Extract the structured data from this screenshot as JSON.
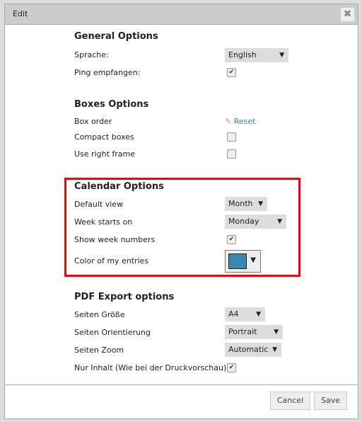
{
  "dialog": {
    "title": "Edit",
    "close_icon": "close-icon"
  },
  "general": {
    "heading": "General Options",
    "language_label": "Sprache:",
    "language_value": "English",
    "ping_label": "Ping empfangen:",
    "ping_checked": true
  },
  "boxes": {
    "heading": "Boxes Options",
    "order_label": "Box order",
    "reset_label": "Reset",
    "compact_label": "Compact boxes",
    "compact_checked": false,
    "right_frame_label": "Use right frame",
    "right_frame_checked": false
  },
  "calendar": {
    "heading": "Calendar Options",
    "default_view_label": "Default view",
    "default_view_value": "Month",
    "week_start_label": "Week starts on",
    "week_start_value": "Monday",
    "week_numbers_label": "Show week numbers",
    "week_numbers_checked": true,
    "color_label": "Color of my entries",
    "color_value": "#3a88b0",
    "highlight_color": "#ff0000"
  },
  "pdf": {
    "heading": "PDF Export options",
    "size_label": "Seiten Größe",
    "size_value": "A4",
    "orientation_label": "Seiten Orientierung",
    "orientation_value": "Portrait",
    "zoom_label": "Seiten Zoom",
    "zoom_value": "Automatic",
    "content_only_label": "Nur Inhalt (Wie bei der Druckvorschau)",
    "content_only_checked": true
  },
  "footer": {
    "cancel_label": "Cancel",
    "save_label": "Save"
  }
}
